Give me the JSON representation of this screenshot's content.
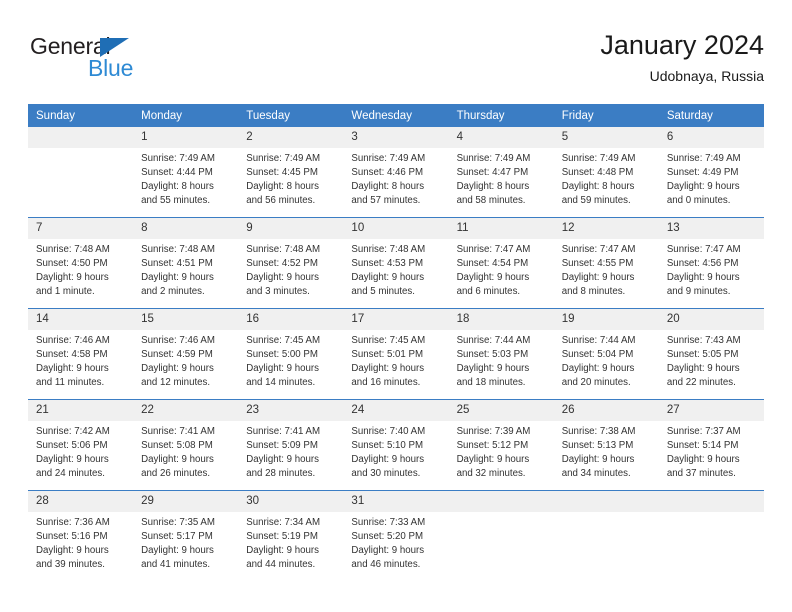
{
  "brand": {
    "name_top": "General",
    "name_bottom": "Blue",
    "triangle_color": "#1f6eb5",
    "blue_color": "#2e8ad4",
    "top_color": "#231f20"
  },
  "header": {
    "title": "January 2024",
    "subtitle": "Udobnaya, Russia"
  },
  "colors": {
    "header_bg": "#3b7dc4",
    "header_text": "#ffffff",
    "daynum_bg": "#f0f0f0",
    "row_separator": "#3b7dc4",
    "body_text": "#333333"
  },
  "calendar": {
    "weekday_headers": [
      "Sunday",
      "Monday",
      "Tuesday",
      "Wednesday",
      "Thursday",
      "Friday",
      "Saturday"
    ],
    "labels": {
      "sunrise": "Sunrise:",
      "sunset": "Sunset:",
      "daylight": "Daylight:"
    },
    "weeks": [
      [
        {
          "day": "",
          "empty": true,
          "sunrise": "",
          "sunset": "",
          "daylight": ""
        },
        {
          "day": "1",
          "sunrise": "Sunrise: 7:49 AM",
          "sunset": "Sunset: 4:44 PM",
          "daylight": "Daylight: 8 hours and 55 minutes."
        },
        {
          "day": "2",
          "sunrise": "Sunrise: 7:49 AM",
          "sunset": "Sunset: 4:45 PM",
          "daylight": "Daylight: 8 hours and 56 minutes."
        },
        {
          "day": "3",
          "sunrise": "Sunrise: 7:49 AM",
          "sunset": "Sunset: 4:46 PM",
          "daylight": "Daylight: 8 hours and 57 minutes."
        },
        {
          "day": "4",
          "sunrise": "Sunrise: 7:49 AM",
          "sunset": "Sunset: 4:47 PM",
          "daylight": "Daylight: 8 hours and 58 minutes."
        },
        {
          "day": "5",
          "sunrise": "Sunrise: 7:49 AM",
          "sunset": "Sunset: 4:48 PM",
          "daylight": "Daylight: 8 hours and 59 minutes."
        },
        {
          "day": "6",
          "sunrise": "Sunrise: 7:49 AM",
          "sunset": "Sunset: 4:49 PM",
          "daylight": "Daylight: 9 hours and 0 minutes."
        }
      ],
      [
        {
          "day": "7",
          "sunrise": "Sunrise: 7:48 AM",
          "sunset": "Sunset: 4:50 PM",
          "daylight": "Daylight: 9 hours and 1 minute."
        },
        {
          "day": "8",
          "sunrise": "Sunrise: 7:48 AM",
          "sunset": "Sunset: 4:51 PM",
          "daylight": "Daylight: 9 hours and 2 minutes."
        },
        {
          "day": "9",
          "sunrise": "Sunrise: 7:48 AM",
          "sunset": "Sunset: 4:52 PM",
          "daylight": "Daylight: 9 hours and 3 minutes."
        },
        {
          "day": "10",
          "sunrise": "Sunrise: 7:48 AM",
          "sunset": "Sunset: 4:53 PM",
          "daylight": "Daylight: 9 hours and 5 minutes."
        },
        {
          "day": "11",
          "sunrise": "Sunrise: 7:47 AM",
          "sunset": "Sunset: 4:54 PM",
          "daylight": "Daylight: 9 hours and 6 minutes."
        },
        {
          "day": "12",
          "sunrise": "Sunrise: 7:47 AM",
          "sunset": "Sunset: 4:55 PM",
          "daylight": "Daylight: 9 hours and 8 minutes."
        },
        {
          "day": "13",
          "sunrise": "Sunrise: 7:47 AM",
          "sunset": "Sunset: 4:56 PM",
          "daylight": "Daylight: 9 hours and 9 minutes."
        }
      ],
      [
        {
          "day": "14",
          "sunrise": "Sunrise: 7:46 AM",
          "sunset": "Sunset: 4:58 PM",
          "daylight": "Daylight: 9 hours and 11 minutes."
        },
        {
          "day": "15",
          "sunrise": "Sunrise: 7:46 AM",
          "sunset": "Sunset: 4:59 PM",
          "daylight": "Daylight: 9 hours and 12 minutes."
        },
        {
          "day": "16",
          "sunrise": "Sunrise: 7:45 AM",
          "sunset": "Sunset: 5:00 PM",
          "daylight": "Daylight: 9 hours and 14 minutes."
        },
        {
          "day": "17",
          "sunrise": "Sunrise: 7:45 AM",
          "sunset": "Sunset: 5:01 PM",
          "daylight": "Daylight: 9 hours and 16 minutes."
        },
        {
          "day": "18",
          "sunrise": "Sunrise: 7:44 AM",
          "sunset": "Sunset: 5:03 PM",
          "daylight": "Daylight: 9 hours and 18 minutes."
        },
        {
          "day": "19",
          "sunrise": "Sunrise: 7:44 AM",
          "sunset": "Sunset: 5:04 PM",
          "daylight": "Daylight: 9 hours and 20 minutes."
        },
        {
          "day": "20",
          "sunrise": "Sunrise: 7:43 AM",
          "sunset": "Sunset: 5:05 PM",
          "daylight": "Daylight: 9 hours and 22 minutes."
        }
      ],
      [
        {
          "day": "21",
          "sunrise": "Sunrise: 7:42 AM",
          "sunset": "Sunset: 5:06 PM",
          "daylight": "Daylight: 9 hours and 24 minutes."
        },
        {
          "day": "22",
          "sunrise": "Sunrise: 7:41 AM",
          "sunset": "Sunset: 5:08 PM",
          "daylight": "Daylight: 9 hours and 26 minutes."
        },
        {
          "day": "23",
          "sunrise": "Sunrise: 7:41 AM",
          "sunset": "Sunset: 5:09 PM",
          "daylight": "Daylight: 9 hours and 28 minutes."
        },
        {
          "day": "24",
          "sunrise": "Sunrise: 7:40 AM",
          "sunset": "Sunset: 5:10 PM",
          "daylight": "Daylight: 9 hours and 30 minutes."
        },
        {
          "day": "25",
          "sunrise": "Sunrise: 7:39 AM",
          "sunset": "Sunset: 5:12 PM",
          "daylight": "Daylight: 9 hours and 32 minutes."
        },
        {
          "day": "26",
          "sunrise": "Sunrise: 7:38 AM",
          "sunset": "Sunset: 5:13 PM",
          "daylight": "Daylight: 9 hours and 34 minutes."
        },
        {
          "day": "27",
          "sunrise": "Sunrise: 7:37 AM",
          "sunset": "Sunset: 5:14 PM",
          "daylight": "Daylight: 9 hours and 37 minutes."
        }
      ],
      [
        {
          "day": "28",
          "sunrise": "Sunrise: 7:36 AM",
          "sunset": "Sunset: 5:16 PM",
          "daylight": "Daylight: 9 hours and 39 minutes."
        },
        {
          "day": "29",
          "sunrise": "Sunrise: 7:35 AM",
          "sunset": "Sunset: 5:17 PM",
          "daylight": "Daylight: 9 hours and 41 minutes."
        },
        {
          "day": "30",
          "sunrise": "Sunrise: 7:34 AM",
          "sunset": "Sunset: 5:19 PM",
          "daylight": "Daylight: 9 hours and 44 minutes."
        },
        {
          "day": "31",
          "sunrise": "Sunrise: 7:33 AM",
          "sunset": "Sunset: 5:20 PM",
          "daylight": "Daylight: 9 hours and 46 minutes."
        },
        {
          "day": "",
          "empty": true,
          "sunrise": "",
          "sunset": "",
          "daylight": ""
        },
        {
          "day": "",
          "empty": true,
          "sunrise": "",
          "sunset": "",
          "daylight": ""
        },
        {
          "day": "",
          "empty": true,
          "sunrise": "",
          "sunset": "",
          "daylight": ""
        }
      ]
    ]
  }
}
